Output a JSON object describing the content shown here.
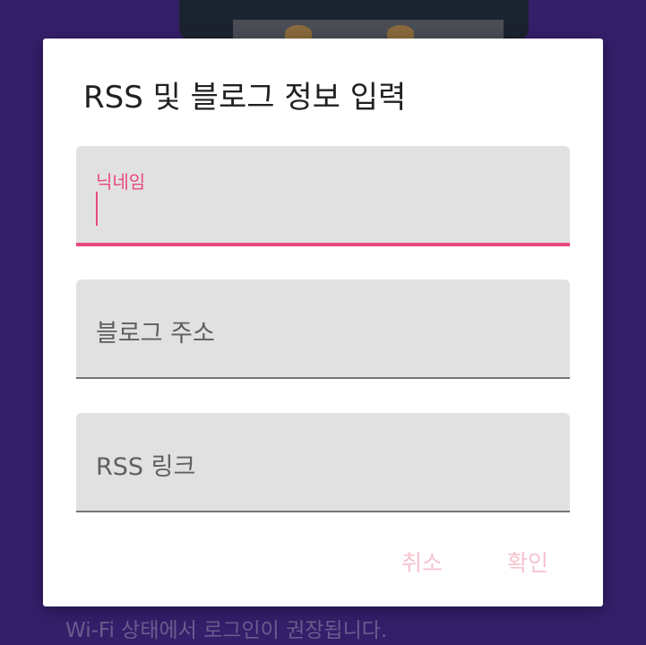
{
  "background": {
    "hint_text": "Wi-Fi 상태에서 로그인이 권장됩니다."
  },
  "dialog": {
    "title": "RSS 및 블로그 정보 입력",
    "fields": [
      {
        "label": "닉네임",
        "value": "",
        "focused": true
      },
      {
        "placeholder": "블로그 주소",
        "value": ""
      },
      {
        "placeholder": "RSS 링크",
        "value": ""
      }
    ],
    "buttons": {
      "cancel": "취소",
      "confirm": "확인"
    }
  },
  "colors": {
    "accent": "#e9497e",
    "button_disabled": "#f6c2cf",
    "backdrop": "#341f6a",
    "field_bg": "#e1e1e1"
  }
}
